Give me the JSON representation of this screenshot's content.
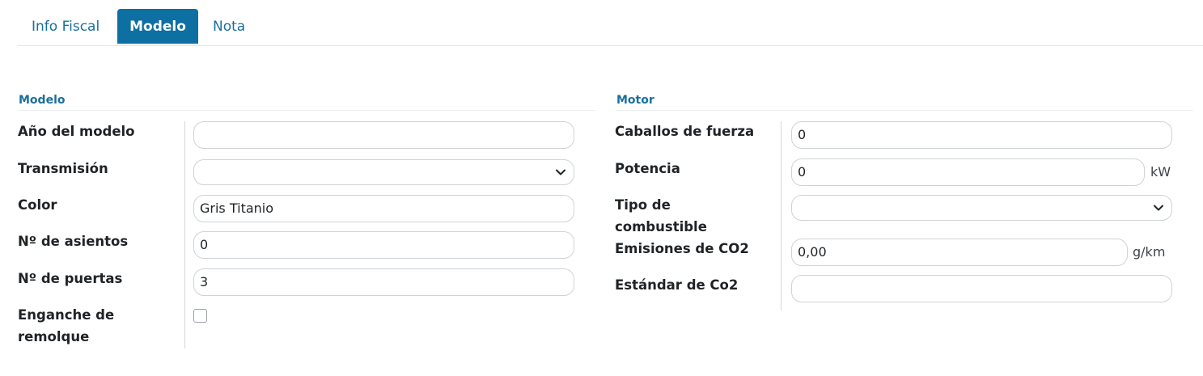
{
  "tabs": [
    {
      "label": "Info Fiscal"
    },
    {
      "label": "Modelo"
    },
    {
      "label": "Nota"
    }
  ],
  "modelo": {
    "title": "Modelo",
    "fields": {
      "year": {
        "label": "Año del modelo",
        "value": ""
      },
      "transmission": {
        "label": "Transmisión",
        "value": ""
      },
      "color": {
        "label": "Color",
        "value": "Gris Titanio"
      },
      "seats": {
        "label": "Nº de asientos",
        "value": "0"
      },
      "doors": {
        "label": "Nº de puertas",
        "value": "3"
      },
      "towing": {
        "label": "Enganche de remolque",
        "checked": false
      }
    }
  },
  "motor": {
    "title": "Motor",
    "fields": {
      "horsepower": {
        "label": "Caballos de fuerza",
        "value": "0"
      },
      "power": {
        "label": "Potencia",
        "value": "0",
        "unit": "kW"
      },
      "fuel": {
        "label": "Tipo de combustible",
        "value": ""
      },
      "co2": {
        "label": "Emisiones de CO2",
        "value": "0,00",
        "unit": "g/km"
      },
      "co2_standard": {
        "label": "Estándar de Co2",
        "value": ""
      }
    }
  },
  "colors": {
    "accent": "#0e6fa3",
    "text": "#1f2326",
    "border": "#cfd3d6"
  }
}
